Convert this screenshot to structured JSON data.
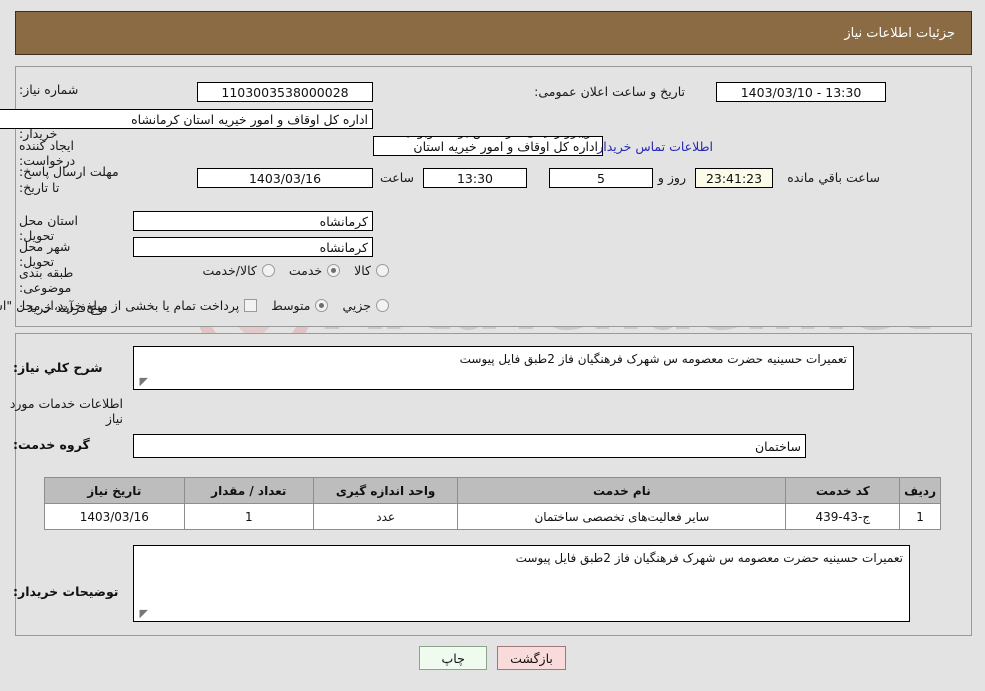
{
  "header": {
    "title": "جزئیات اطلاعات نیاز",
    "bar_color": "#8b6b43"
  },
  "watermark": {
    "text": "ArtaTender.net",
    "shield_color": "#e8c3c3"
  },
  "summary": {
    "need_number": {
      "label": "شماره نیاز:",
      "value": "1103003538000028"
    },
    "announce_datetime": {
      "label": "تاریخ و ساعت اعلان عمومی:",
      "value": "13:30 - 1403/03/10"
    },
    "buyer_org": {
      "label": "نام دستگاه خریدار:",
      "value": "اداره کل اوقاف و امور خیریه استان کرمانشاه"
    },
    "request_creator": {
      "label": "ایجاد کننده درخواست:",
      "value": "فریبرز رحیمی کارشناس برنامه وبودجه اداره کل اوقاف و امور خیریه استان کرمان",
      "contact_link": "اطلاعات تماس خریدار"
    },
    "deadline": {
      "label": "مهلت ارسال پاسخ: تا تاریخ:",
      "date": "1403/03/16",
      "time_label": "ساعت",
      "time": "13:30",
      "days": "5",
      "days_label": "روز و",
      "countdown": "23:41:23",
      "countdown_label": "ساعت باقي مانده"
    },
    "delivery_province": {
      "label": "استان محل تحویل:",
      "value": "کرمانشاه"
    },
    "delivery_city": {
      "label": "شهر محل تحویل:",
      "value": "کرمانشاه"
    },
    "subject_class": {
      "label": "طبقه بندی موضوعی:",
      "options": [
        {
          "label": "کالا",
          "selected": false
        },
        {
          "label": "خدمت",
          "selected": true
        },
        {
          "label": "کالا/خدمت",
          "selected": false
        }
      ]
    },
    "purchase_process": {
      "label": "نوع فرآیند خرید :",
      "options": [
        {
          "label": "جزیي",
          "selected": false
        },
        {
          "label": "متوسط",
          "selected": true
        }
      ],
      "treasury_checkbox": {
        "checked": false,
        "text": "پرداخت تمام یا بخشی از مبلغ خرید،از محل \"اسناد خزانه اسلامی\" خواهد بود."
      }
    }
  },
  "details": {
    "general_desc": {
      "label": "شرح کلي نیاز:",
      "value": "تعمیرات حسینیه حضرت معصومه س شهرک فرهنگیان فاز 2طبق فایل پیوست"
    },
    "services_section_title": "اطلاعات خدمات مورد نیاز",
    "service_group": {
      "label": "گروه خدمت:",
      "value": "ساختمان"
    },
    "table": {
      "columns": [
        "ردیف",
        "کد خدمت",
        "نام خدمت",
        "واحد اندازه گیری",
        "تعداد / مقدار",
        "تاریخ نیاز"
      ],
      "rows": [
        {
          "row": "1",
          "code": "ج-43-439",
          "name": "سایر فعالیت‌های تخصصی ساختمان",
          "unit": "عدد",
          "qty": "1",
          "need_date": "1403/03/16"
        }
      ]
    },
    "buyer_notes": {
      "label": "توضیحات خریدار:",
      "value": "تعمیرات حسینیه حضرت معصومه س شهرک فرهنگیان فاز 2طبق فایل پیوست"
    }
  },
  "footer": {
    "back_button": "بازگشت",
    "print_button": "چاپ"
  }
}
